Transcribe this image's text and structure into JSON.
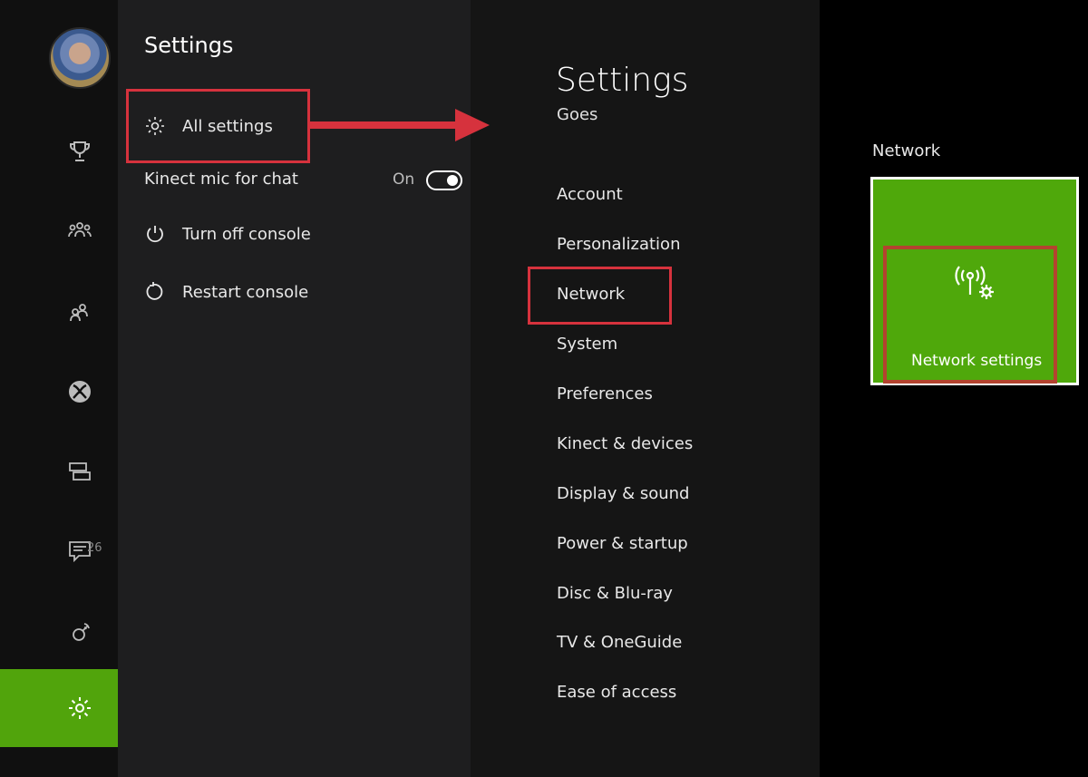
{
  "rail": {
    "items": [
      {
        "icon": "trophy-icon"
      },
      {
        "icon": "friends-icon"
      },
      {
        "icon": "party-icon"
      },
      {
        "icon": "xbox-icon"
      },
      {
        "icon": "messages-icon"
      },
      {
        "icon": "notifications-icon",
        "badge": "26"
      },
      {
        "icon": "broadcast-icon"
      },
      {
        "icon": "settings-gear-icon",
        "selected": true
      }
    ],
    "accent": "#51a40c"
  },
  "guide": {
    "title": "Settings",
    "all_settings": "All settings",
    "kinect_mic": "Kinect mic for chat",
    "kinect_mic_state": "On",
    "turn_off": "Turn off console",
    "restart": "Restart console"
  },
  "settings": {
    "title": "Settings",
    "user": "Goes",
    "menu": [
      "Account",
      "Personalization",
      "Network",
      "System",
      "Preferences",
      "Kinect & devices",
      "Display & sound",
      "Power & startup",
      "Disc & Blu-ray",
      "TV & OneGuide",
      "Ease of access"
    ]
  },
  "detail": {
    "section": "Network",
    "tile_label": "Network settings",
    "tile_icon": "network-settings-icon",
    "tile_color": "#4fa80b"
  },
  "annotation_color": "#d6323d"
}
